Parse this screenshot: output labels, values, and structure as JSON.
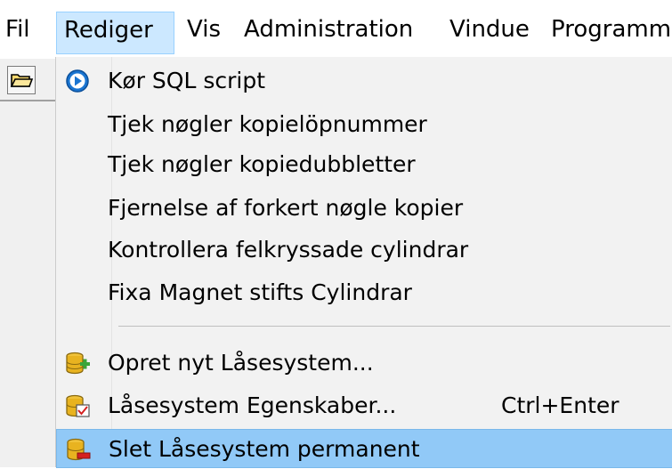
{
  "menubar": {
    "items": [
      {
        "label": "Fil"
      },
      {
        "label": "Rediger"
      },
      {
        "label": "Vis"
      },
      {
        "label": "Administration"
      },
      {
        "label": "Vindue"
      },
      {
        "label": "Programm"
      }
    ]
  },
  "toolbar": {
    "open_icon": "open-folder-icon"
  },
  "dropdown": {
    "items": [
      {
        "label": "Kør SQL script",
        "icon": "run-circle-icon"
      },
      {
        "label": "Tjek nøgler kopielöpnummer"
      },
      {
        "label": "Tjek nøgler kopiedubbletter"
      },
      {
        "label": "Fjernelse af forkert nøgle kopier"
      },
      {
        "label": "Kontrollera felkryssade cylindrar"
      },
      {
        "label": "Fixa Magnet stifts Cylindrar"
      },
      {
        "label": "Opret nyt Låsesystem...",
        "icon": "database-add-icon"
      },
      {
        "label": "Låsesystem Egenskaber...",
        "shortcut": "Ctrl+Enter",
        "icon": "database-properties-icon"
      },
      {
        "label": "Slet Låsesystem permanent",
        "icon": "database-delete-icon"
      }
    ]
  },
  "colors": {
    "active_menu_bg": "#cce8ff",
    "highlight_bg": "#91c9f7",
    "menu_bg": "#f2f2f2"
  }
}
